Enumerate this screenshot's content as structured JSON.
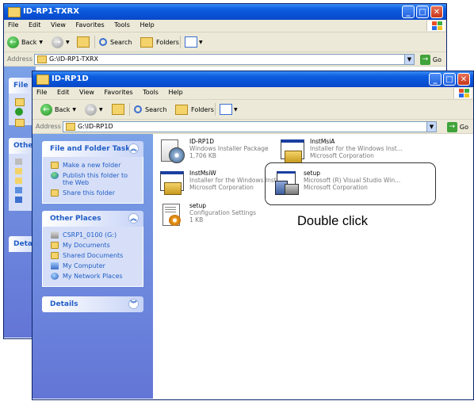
{
  "back_window": {
    "title": "ID-RP1-TXRX",
    "menu": [
      "File",
      "Edit",
      "View",
      "Favorites",
      "Tools",
      "Help"
    ],
    "toolbar": {
      "back": "Back",
      "search": "Search",
      "folders": "Folders"
    },
    "address_label": "Address",
    "address_value": "G:\\ID-RP1-TXRX",
    "side_labels": [
      "File",
      "Othe",
      "Deta"
    ]
  },
  "front_window": {
    "title": "ID-RP1D",
    "menu": [
      "File",
      "Edit",
      "View",
      "Favorites",
      "Tools",
      "Help"
    ],
    "toolbar": {
      "back": "Back",
      "search": "Search",
      "folders": "Folders"
    },
    "address_label": "Address",
    "address_value": "G:\\ID-RP1D",
    "go_label": "Go",
    "task_pane": {
      "file_tasks": {
        "title": "File and Folder Tasks",
        "items": [
          "Make a new folder",
          "Publish this folder to the Web",
          "Share this folder"
        ]
      },
      "other_places": {
        "title": "Other Places",
        "items": [
          "CSRP1_0100 (G:)",
          "My Documents",
          "Shared Documents",
          "My Computer",
          "My Network Places"
        ]
      },
      "details": {
        "title": "Details"
      }
    },
    "files": [
      {
        "name": "ID-RP1D",
        "line2": "Windows Installer Package",
        "line3": "1,706 KB",
        "icon": "installer-package-icon"
      },
      {
        "name": "InstMsiA",
        "line2": "Installer for the Windows Inst...",
        "line3": "Microsoft Corporation",
        "icon": "installer-exe-icon"
      },
      {
        "name": "InstMsiW",
        "line2": "Installer for the Windows Inst...",
        "line3": "Microsoft Corporation",
        "icon": "installer-exe-icon"
      },
      {
        "name": "setup",
        "line2": "Microsoft (R) Visual Studio Win...",
        "line3": "Microsoft Corporation",
        "icon": "setup-exe-icon"
      },
      {
        "name": "setup",
        "line2": "Configuration Settings",
        "line3": "1 KB",
        "icon": "config-file-icon"
      }
    ]
  },
  "annotation": {
    "text": "Double click"
  },
  "colors": {
    "title_blue": "#0a48c8",
    "taskpane_blue": "#6f8fe0",
    "link_blue": "#215dc6",
    "chrome": "#ece9d8"
  }
}
